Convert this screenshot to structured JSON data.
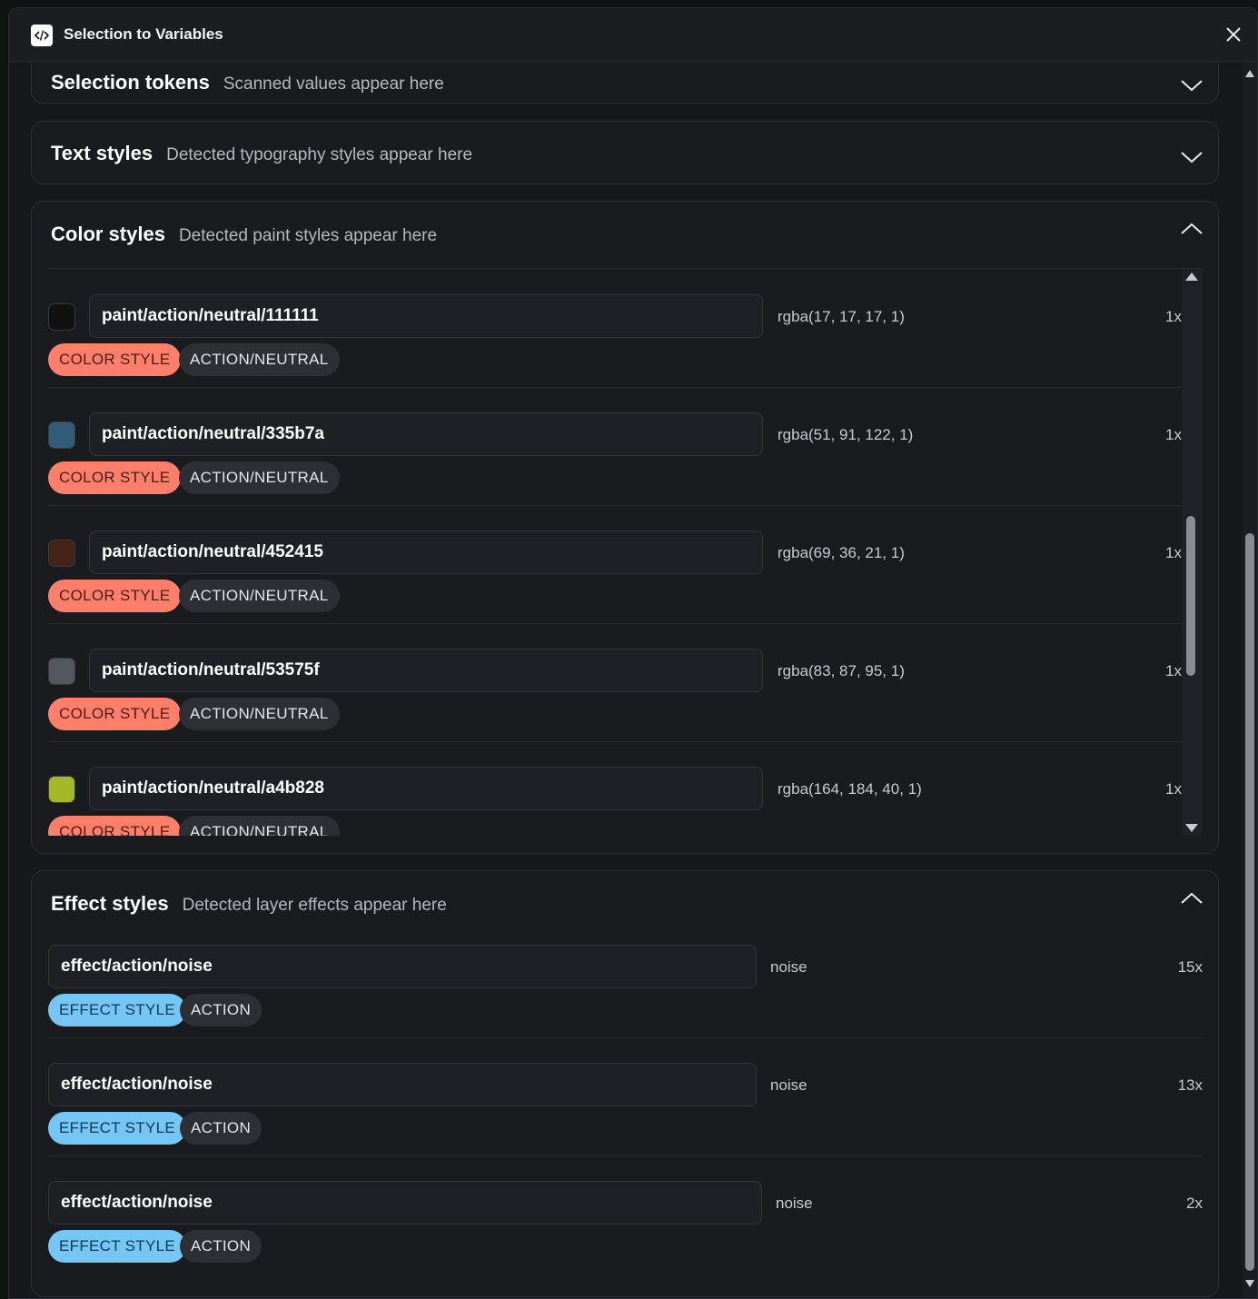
{
  "window": {
    "title": "Selection to Variables"
  },
  "panels": {
    "selection_tokens": {
      "title": "Selection tokens",
      "subtitle": "Scanned values appear here"
    },
    "text_styles": {
      "title": "Text styles",
      "subtitle": "Detected typography styles appear here"
    },
    "color_styles": {
      "title": "Color styles",
      "subtitle": "Detected paint styles appear here",
      "items": [
        {
          "name": "paint/action/neutral/111111",
          "value": "rgba(17, 17, 17, 1)",
          "count": "1x",
          "swatch": "#111111",
          "tag": "COLOR STYLE",
          "group": "ACTION/NEUTRAL"
        },
        {
          "name": "paint/action/neutral/335b7a",
          "value": "rgba(51, 91, 122, 1)",
          "count": "1x",
          "swatch": "#335b7a",
          "tag": "COLOR STYLE",
          "group": "ACTION/NEUTRAL"
        },
        {
          "name": "paint/action/neutral/452415",
          "value": "rgba(69, 36, 21, 1)",
          "count": "1x",
          "swatch": "#452415",
          "tag": "COLOR STYLE",
          "group": "ACTION/NEUTRAL"
        },
        {
          "name": "paint/action/neutral/53575f",
          "value": "rgba(83, 87, 95, 1)",
          "count": "1x",
          "swatch": "#53575f",
          "tag": "COLOR STYLE",
          "group": "ACTION/NEUTRAL"
        },
        {
          "name": "paint/action/neutral/a4b828",
          "value": "rgba(164, 184, 40, 1)",
          "count": "1x",
          "swatch": "#a4b828",
          "tag": "COLOR STYLE",
          "group": "ACTION/NEUTRAL"
        }
      ]
    },
    "effect_styles": {
      "title": "Effect styles",
      "subtitle": "Detected layer effects appear here",
      "items": [
        {
          "name": "effect/action/noise",
          "value": "noise",
          "count": "15x",
          "tag": "EFFECT STYLE",
          "group": "ACTION"
        },
        {
          "name": "effect/action/noise",
          "value": "noise",
          "count": "13x",
          "tag": "EFFECT STYLE",
          "group": "ACTION"
        },
        {
          "name": "effect/action/noise",
          "value": "noise",
          "count": "2x",
          "tag": "EFFECT STYLE",
          "group": "ACTION"
        }
      ]
    }
  },
  "colors": {
    "color_tag": "#ff7f6b",
    "effect_tag": "#74c7f5",
    "background": "#17181c"
  }
}
